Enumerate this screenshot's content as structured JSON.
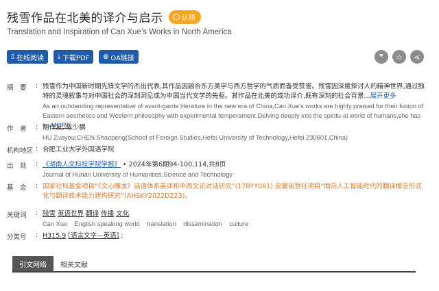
{
  "title_zh": "残雪作品在北美的译介与启示",
  "claim_label": "认领",
  "title_en": "Translation and Inspiration of Can Xue’s Works in North America",
  "actions": {
    "read_online": "在线阅读",
    "download_pdf": "下载PDF",
    "oa_link": "OA链接"
  },
  "icons": {
    "quote": "quote-icon",
    "star": "star-icon",
    "share": "share-icon"
  },
  "meta": {
    "abstract": {
      "label": "摘　要",
      "zh": "残雪作为中国新时期先锋文学的杰出代表,其作品因融合东方美学与西方哲学的气质而备受赞誉。残雪因深度探讨人的精神世界,通过独特的灵魂叙事与对中国社会的深刻洞见成为中国当代文学的先驱。其作品在北美的成功译介,既有深刻的社会背景...",
      "zh_more": "展开更多",
      "en": "As an outstanding representative of avant-garde literature in the new era of China,Can Xue’s works are highly praised for their fusion of Eastern aesthetics and Western philosophy with experimental temperament.Delving deeply into the spiritu-al world of humans,she has b...",
      "en_more": "MORE"
    },
    "authors": {
      "label": "作　者",
      "zh": "胡作友, 陈少鹏",
      "en": "HU Zuoyou;CHEN Shaopeng(School of Foreign Studies,Hefei University of Technology,Hefei 230601,China)"
    },
    "region": {
      "label": "机构地区",
      "value": "合肥工业大学外国语学院"
    },
    "source": {
      "label": "出　处",
      "journal": "《湖南人文科技学院学报》",
      "detail": "2024年第6期94-100,114,共8页",
      "en": "Journal of Hunan University of Humanities,Science and Technology"
    },
    "fund": {
      "label": "基　金",
      "value": "国家社科基金项目“《文心雕龙》话语体系英译和中西文论对话研究”(17BYY061) 安徽省哲社项目“面向人工智能时代的翻译概念形式化与翻译技术能力建构研究”(AHSKY2022D223)。"
    },
    "keywords": {
      "label": "关键词",
      "zh": [
        "残雪",
        "英语世界",
        "翻译",
        "传播",
        "文化"
      ],
      "en": [
        "Can Xue",
        "English speaking world",
        "translation",
        "dissemination",
        "culture"
      ]
    },
    "classification": {
      "label": "分类号",
      "code": "H315.9",
      "desc": "[语言文字—英语]",
      "tail": ";"
    }
  },
  "tabs": [
    "引文网络",
    "相关文献"
  ]
}
